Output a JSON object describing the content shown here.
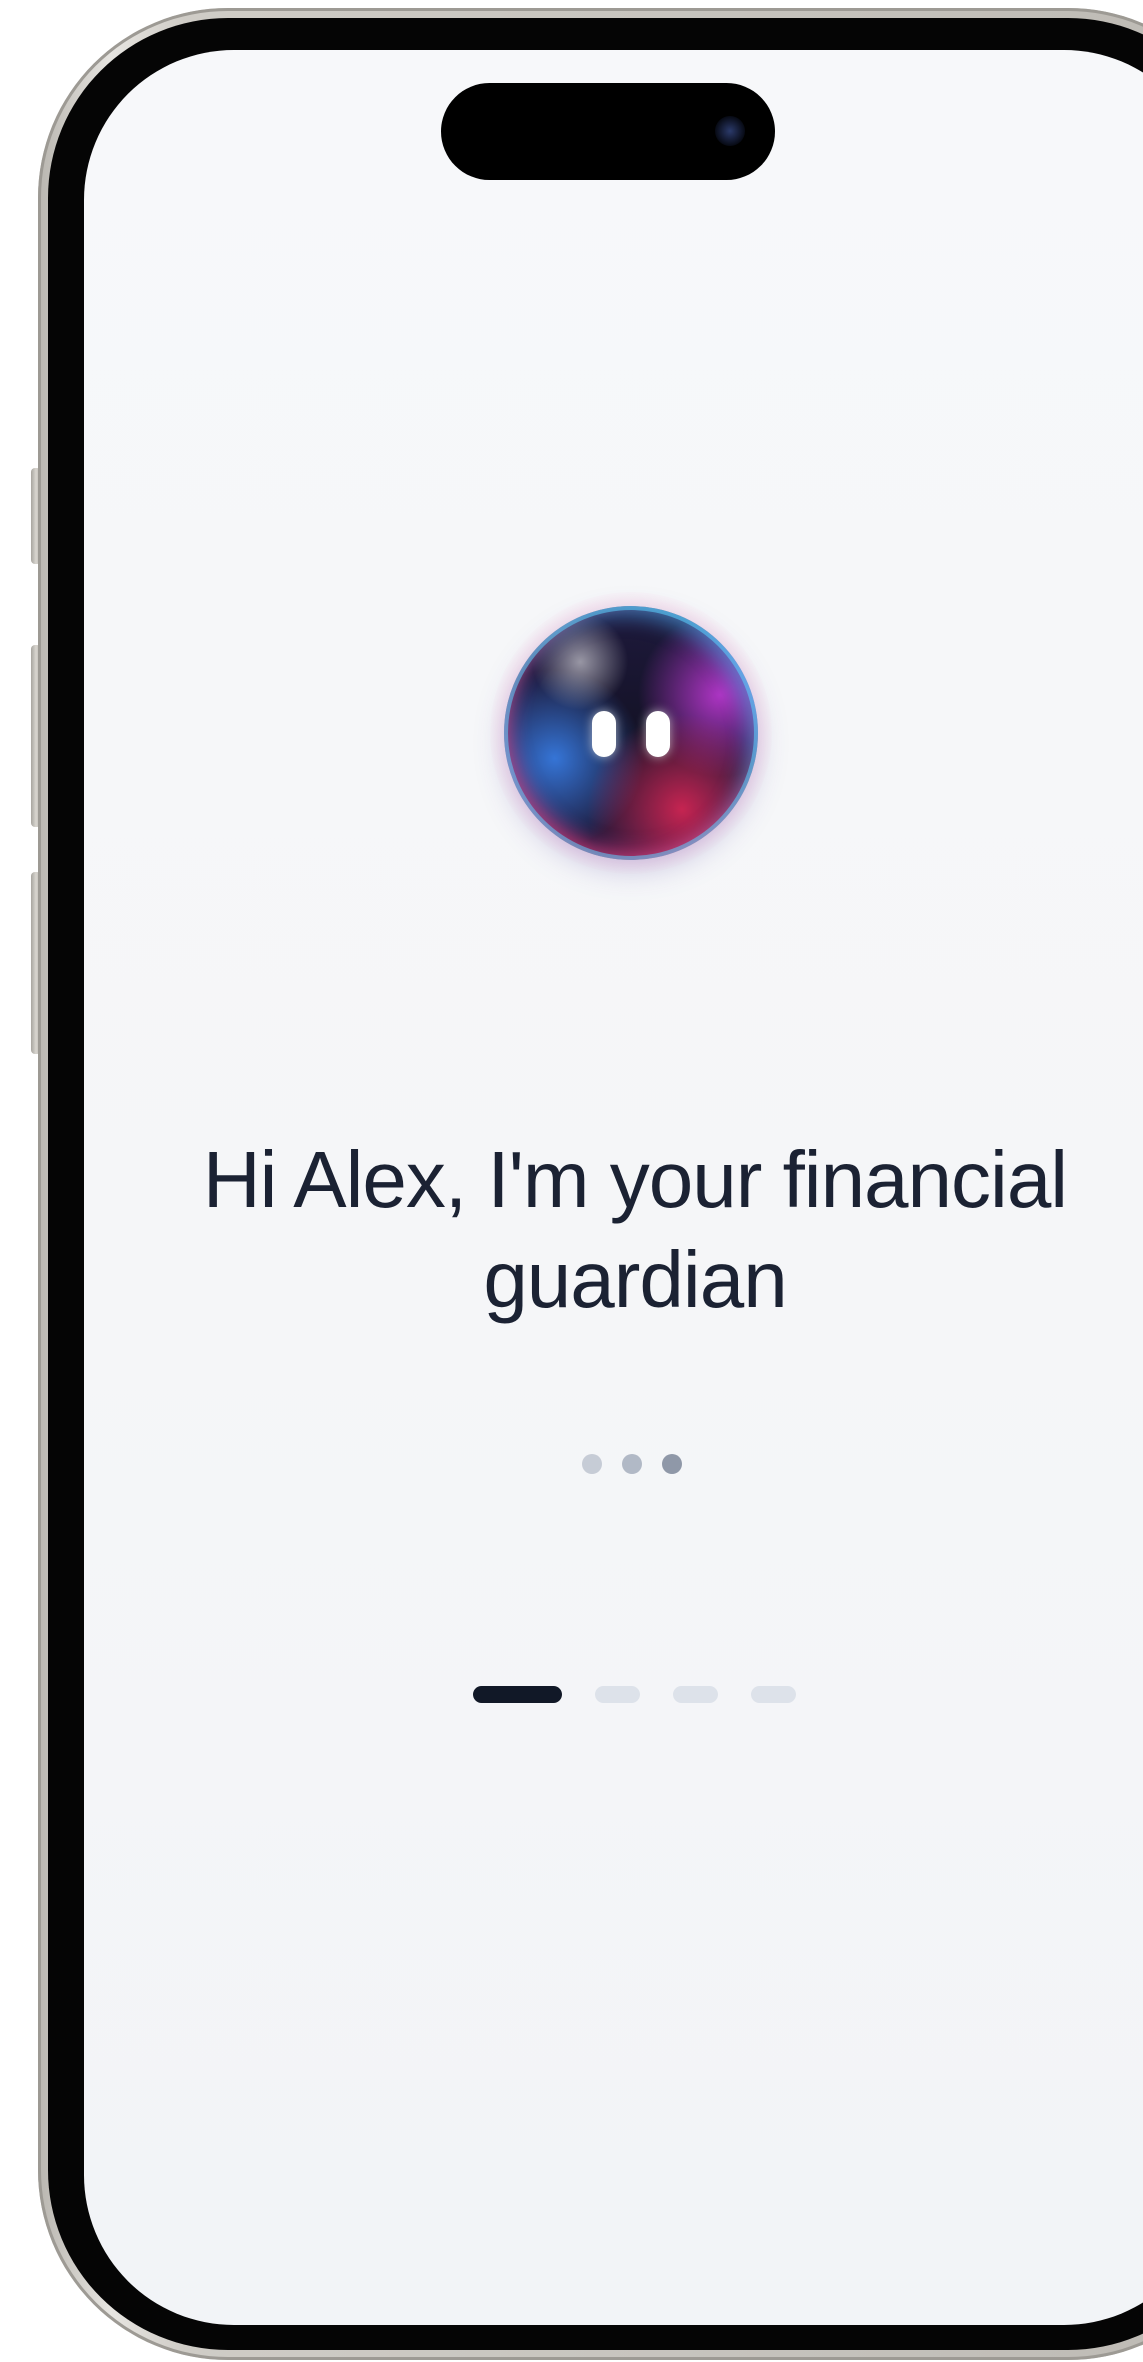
{
  "onboarding": {
    "greeting": "Hi Alex, I'm your financial guardian",
    "avatar_icon": "ai-orb-icon",
    "typing_indicator_icon": "typing-dots-icon",
    "pager": {
      "total_pages": 4,
      "current_page": 1
    }
  },
  "colors": {
    "background": "#f6f7f9",
    "text": "#1b2233",
    "pager_active": "#111827",
    "pager_inactive": "#dde2ea"
  }
}
